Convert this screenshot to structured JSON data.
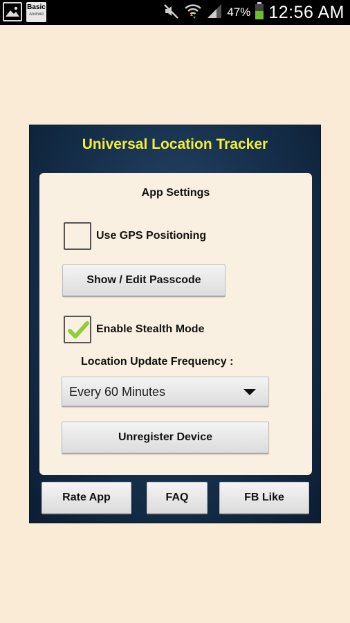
{
  "status_bar": {
    "notification_icons": [
      "gallery-icon",
      "basic-android-app-icon"
    ],
    "basic_app_label": "Basic",
    "basic_app_sublabel": "Android",
    "system_icons": [
      "mute-icon",
      "wifi-icon",
      "signal-icon"
    ],
    "battery_percent": "47%",
    "battery_level": 0.47,
    "time": "12:56 AM"
  },
  "app": {
    "title": "Universal Location Tracker",
    "title_color": "#f4ee3a",
    "settings": {
      "heading": "App Settings",
      "gps": {
        "label": "Use GPS Positioning",
        "checked": false
      },
      "passcode_button": "Show / Edit Passcode",
      "stealth": {
        "label": "Enable Stealth Mode",
        "checked": true
      },
      "frequency_label": "Location Update Frequency :",
      "frequency_value": "Every 60 Minutes",
      "unregister_button": "Unregister Device"
    },
    "footer": {
      "rate_button": "Rate App",
      "faq_button": "FAQ",
      "fb_button": "FB Like"
    }
  }
}
